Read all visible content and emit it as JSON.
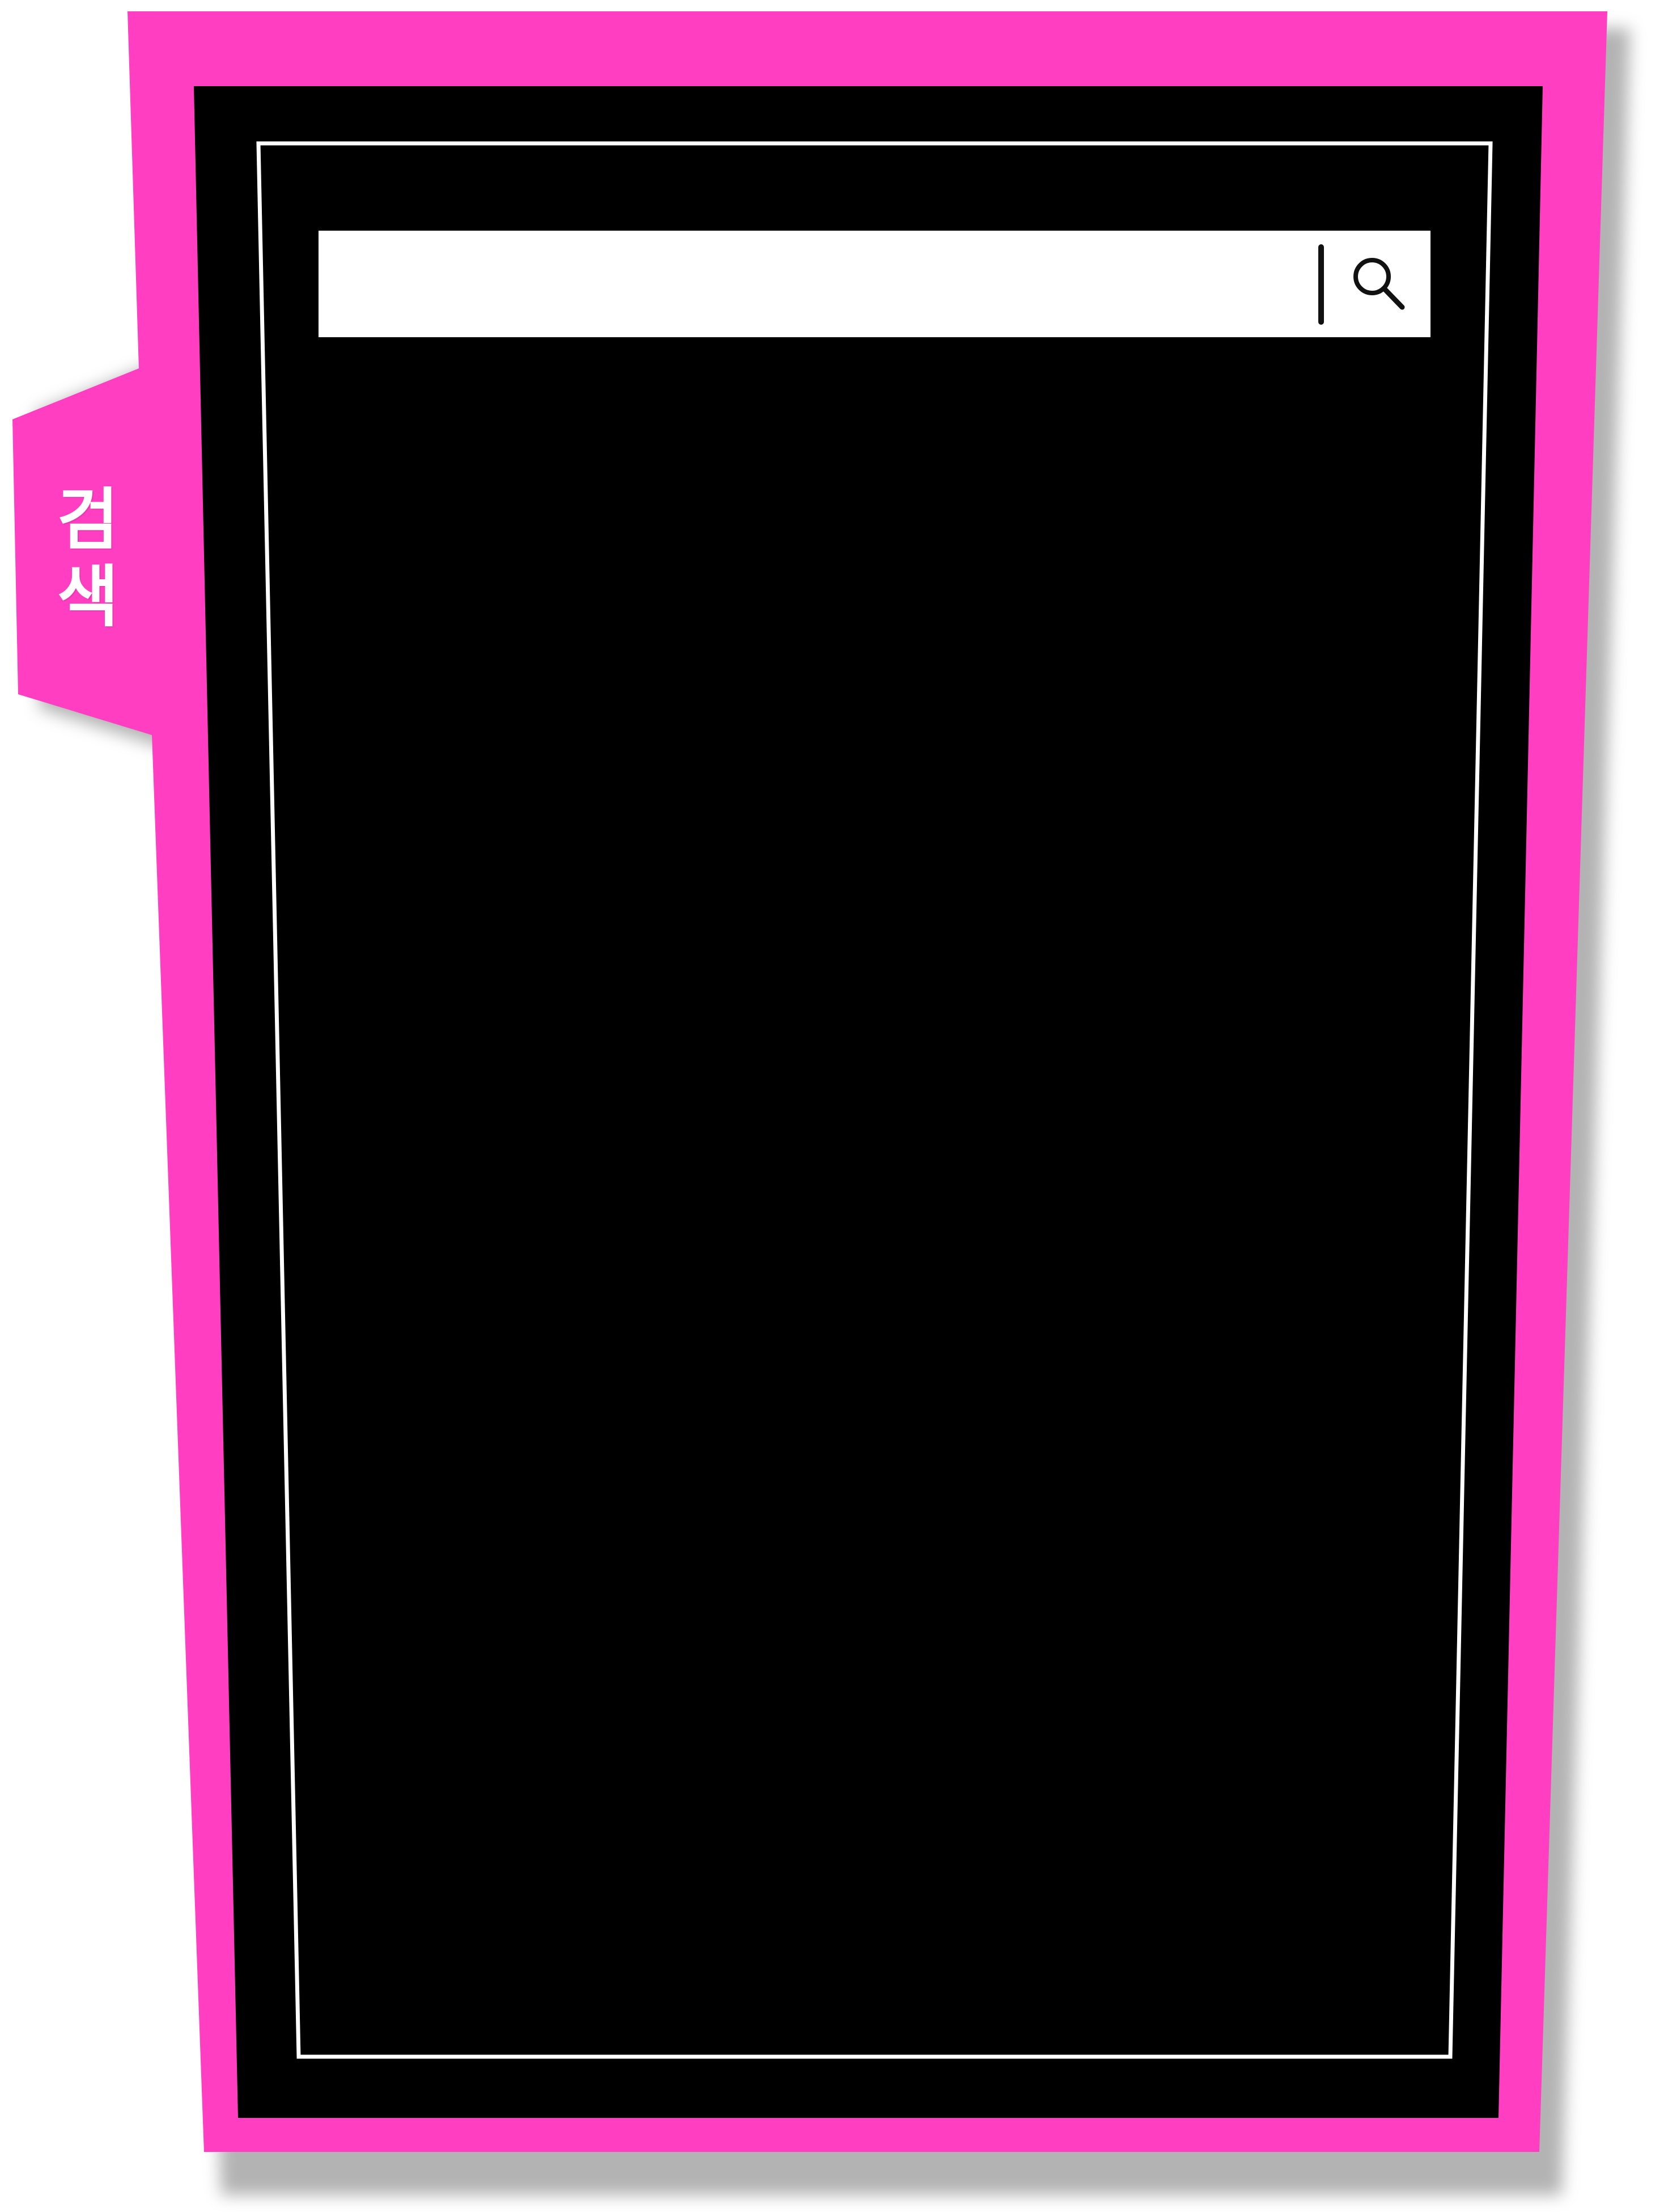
{
  "tab": {
    "chars": [
      "검",
      "색"
    ]
  },
  "search": {
    "value": "",
    "placeholder": "",
    "button_icon": "search-icon"
  },
  "colors": {
    "accent": "#ff3ec1",
    "panel": "#000000",
    "inner_border": "#ffffff",
    "search_bg": "#ffffff",
    "shadow": "#9a9a9a"
  }
}
